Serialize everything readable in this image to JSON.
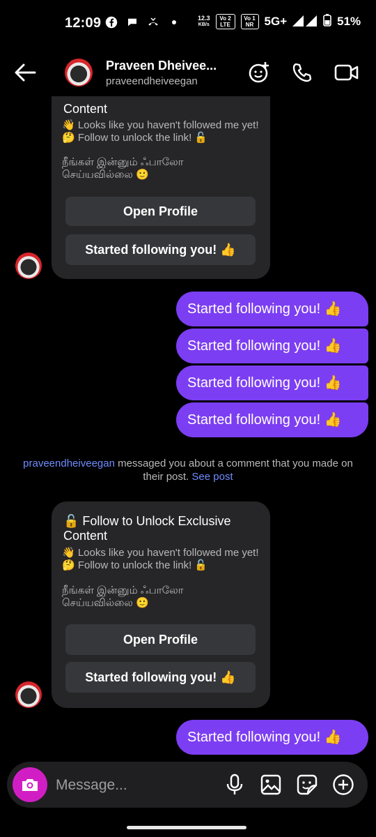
{
  "status_bar": {
    "time": "12:09",
    "net_speed_value": "12.3",
    "net_speed_unit": "KB/s",
    "volte1": "Vo 2 LTE",
    "volte2": "Vo 1 NR",
    "network": "5G+",
    "battery": "51%"
  },
  "header": {
    "name": "Praveen Dheivee...",
    "username": "praveendheiveegan"
  },
  "card1": {
    "title_tail": "Content",
    "body_en": "👋 Looks like you haven't followed me yet! 🤔 Follow to unlock the link! 🔓",
    "body_ta": "நீங்கள் இன்னும் ஃபாலோ செய்யவில்லை 🙂",
    "button_profile": "Open Profile",
    "button_follow": "Started following you! 👍"
  },
  "sent_messages": [
    "Started following you! 👍",
    "Started following you! 👍",
    "Started following you! 👍",
    "Started following you! 👍"
  ],
  "notice": {
    "username": "praveendheiveegan",
    "text": "messaged you about a comment that you made on their post.",
    "link": "See post"
  },
  "card2": {
    "title": "🔓 Follow to Unlock Exclusive Content",
    "body_en": "👋 Looks like you haven't followed me yet! 🤔 Follow to unlock the link! 🔓",
    "body_ta": "நீங்கள் இன்னும் ஃபாலோ செய்யவில்லை 🙂",
    "button_profile": "Open Profile",
    "button_follow": "Started following you! 👍"
  },
  "last_sent": "Started following you! 👍",
  "composer": {
    "placeholder": "Message..."
  },
  "colors": {
    "bubble": "#7c3ef2",
    "camera": "#d11ec4",
    "card": "#262628",
    "link": "#6f8cff"
  }
}
